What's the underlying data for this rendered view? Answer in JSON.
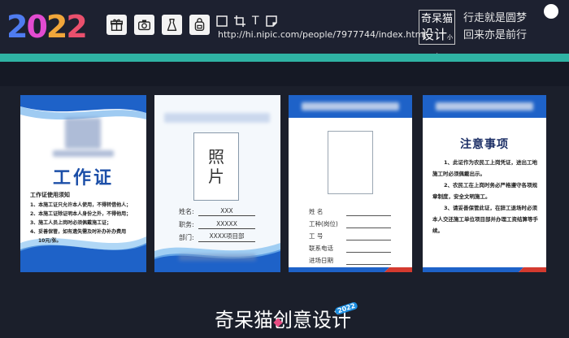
{
  "header": {
    "year_digits": [
      "2",
      "0",
      "2",
      "2"
    ],
    "tool_icons": [
      "gift-icon",
      "camera-icon",
      "dress-icon",
      "backpack-icon"
    ],
    "mini_tool_icons": [
      "square-icon",
      "crop-icon",
      "text-icon",
      "stamp-icon"
    ],
    "mini_text_tool": "T",
    "url": "http://hi.nipic.com/people/7977744/index.html",
    "brand_box_line1": "奇呆猫",
    "brand_box_line2": "设计",
    "brand_box_small": "小店",
    "slogan_line1": "行走就是圆梦",
    "slogan_line2": "回来亦是前行"
  },
  "colors": {
    "teal": "#2fb3a4",
    "card_blue": "#1c4fa8",
    "wave_blue": "#1e62c8",
    "accent_red": "#d43a2f"
  },
  "card1": {
    "title": "工作证",
    "subtitle": "工作证使用须知",
    "rules": [
      "1、本施工证只允许本人使用，不得转借他人；",
      "2、本施工证除证明本人身份之外，不得他用；",
      "3、施工人员上岗时必须佩戴施工证；",
      "4、妥善保管，如有遗失需及时补办补办费用",
      "10元/张。"
    ]
  },
  "card2": {
    "photo_label_1": "照",
    "photo_label_2": "片",
    "fields": [
      {
        "label": "姓名:",
        "value": "XXX"
      },
      {
        "label": "职务:",
        "value": "XXXXX"
      },
      {
        "label": "部门:",
        "value": "XXXX项目部"
      }
    ]
  },
  "card3": {
    "fields": [
      "姓    名",
      "工种(岗位)",
      "工    号",
      "联系电话",
      "进场日期"
    ]
  },
  "card4": {
    "title": "注意事项",
    "paragraphs": [
      "1、此证作为农民工上岗凭证，进出工地施工时必须佩戴出示。",
      "2、农民工在上岗时务必严格遵守各项规章制度，安全文明施工。",
      "3、请妥善保管此证，在辞工退场时必须本人交还施工单位项目部并办理工资结算等手续。"
    ]
  },
  "footer": {
    "logo_text": "奇呆猫创意设计",
    "badge": "2022"
  }
}
